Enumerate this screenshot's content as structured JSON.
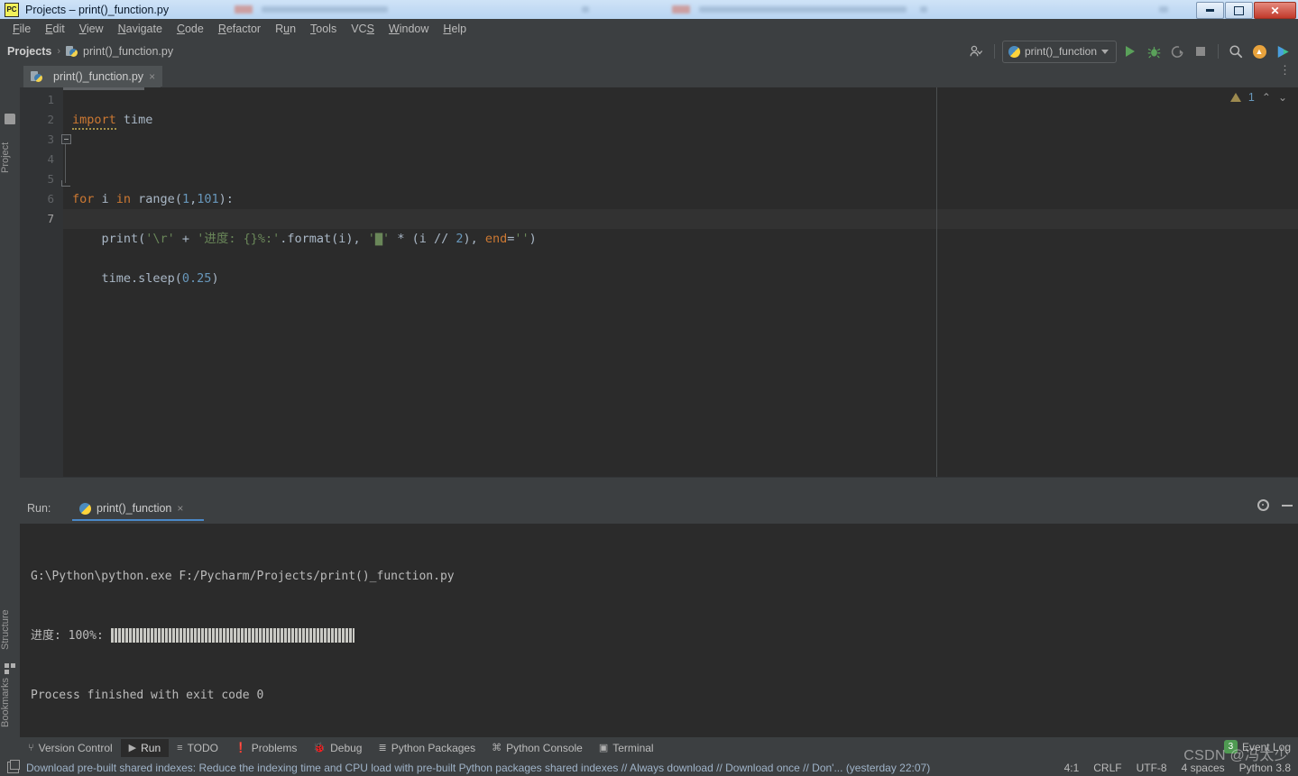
{
  "window": {
    "title": "Projects – print()_function.py",
    "app_icon": "pycharm-icon",
    "buttons": {
      "minimize": "minimize-icon",
      "restore": "restore-icon",
      "close": "✕"
    }
  },
  "menubar": {
    "items": [
      {
        "label": "File",
        "mnemonic": "F"
      },
      {
        "label": "Edit",
        "mnemonic": "E"
      },
      {
        "label": "View",
        "mnemonic": "V"
      },
      {
        "label": "Navigate",
        "mnemonic": "N"
      },
      {
        "label": "Code",
        "mnemonic": "C"
      },
      {
        "label": "Refactor",
        "mnemonic": "R"
      },
      {
        "label": "Run",
        "mnemonic": "u"
      },
      {
        "label": "Tools",
        "mnemonic": "T"
      },
      {
        "label": "VCS",
        "mnemonic": "S"
      },
      {
        "label": "Window",
        "mnemonic": "W"
      },
      {
        "label": "Help",
        "mnemonic": "H"
      }
    ]
  },
  "breadcrumb": {
    "root": "Projects",
    "separator": "›",
    "file": "print()_function.py"
  },
  "toolbar": {
    "account_icon": "account-icon",
    "run_config": "print()_function",
    "run_icon": "run-icon",
    "debug_icon": "debug-icon",
    "coverage_icon": "run-with-coverage-icon",
    "stop_icon": "stop-icon",
    "search_icon": "search-icon",
    "update_icon": "update-project-icon",
    "feature_icon": "feature-trainer-icon"
  },
  "left_stripe": {
    "project": "Project",
    "structure": "Structure",
    "bookmarks": "Bookmarks"
  },
  "editor": {
    "tab_label": "print()_function.py",
    "tab_close": "×",
    "more_icon": "more-options-icon",
    "line_numbers": [
      "1",
      "2",
      "3",
      "4",
      "5",
      "6",
      "7"
    ],
    "current_line": 7,
    "warning_count": "1",
    "chevron_up": "⌃",
    "chevron_down": "⌄",
    "code": {
      "l1": {
        "kw": "import",
        "rest": " time"
      },
      "l3": {
        "p1": "for",
        "p2": " i ",
        "p3": "in",
        "p4": " range(",
        "n1": "1",
        "c": ",",
        "n2": "101",
        "p5": "):"
      },
      "l4": {
        "a": "    print(",
        "s1": "'\\r'",
        "b": " + ",
        "s2": "'进度: {}%:'",
        "c": ".format(i), ",
        "q1": "'",
        "block": "▇",
        "q2": "'",
        "d": " * (i // ",
        "n": "2",
        "e": "), ",
        "param": "end",
        "f": "=",
        "s3": "''",
        "g": ")"
      },
      "l5": {
        "a": "    time.sleep(",
        "n": "0.25",
        "b": ")"
      }
    }
  },
  "run_panel": {
    "label": "Run:",
    "tab_label": "print()_function",
    "tab_close": "×",
    "settings_icon": "settings-gear-icon",
    "hide_icon": "hide-panel-icon",
    "console": {
      "command": "G:\\Python\\python.exe F:/Pycharm/Projects/print()_function.py",
      "progress_label": "进度: 100%:",
      "progress_percent": 100,
      "exit_line": "Process finished with exit code 0"
    }
  },
  "tool_windows": [
    {
      "label": "Version Control",
      "icon": "⑂",
      "active": false
    },
    {
      "label": "Run",
      "icon": "▶",
      "active": true
    },
    {
      "label": "TODO",
      "icon": "≡",
      "active": false
    },
    {
      "label": "Problems",
      "icon": "❗",
      "active": false
    },
    {
      "label": "Debug",
      "icon": "🐞",
      "active": false
    },
    {
      "label": "Python Packages",
      "icon": "≣",
      "active": false
    },
    {
      "label": "Python Console",
      "icon": "⌘",
      "active": false
    },
    {
      "label": "Terminal",
      "icon": "▣",
      "active": false
    }
  ],
  "event_log": {
    "label": "Event Log",
    "count": "3"
  },
  "status_bar": {
    "hint_icon": "hint-icon",
    "message": "Download pre-built shared indexes: Reduce the indexing time and CPU load with pre-built Python packages shared indexes // Always download // Download once // Don'... (yesterday 22:07)",
    "caret_position": "4:1",
    "line_separator": "CRLF",
    "encoding": "UTF-8",
    "indent": "4 spaces",
    "interpreter": "Python 3.8"
  },
  "watermark": "CSDN @冯太少"
}
